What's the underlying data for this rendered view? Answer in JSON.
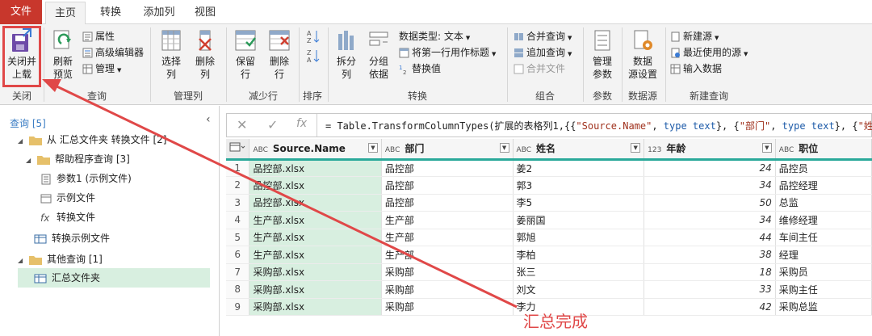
{
  "tabs": {
    "file": "文件",
    "home": "主页",
    "transform": "转换",
    "add_column": "添加列",
    "view": "视图"
  },
  "ribbon": {
    "close": {
      "button": "关闭并\n上载",
      "group": "关闭"
    },
    "query": {
      "refresh": "刷新\n预览",
      "properties": "属性",
      "advanced_editor": "高级编辑器",
      "manage": "管理",
      "group": "查询"
    },
    "manage_columns": {
      "choose": "选择\n列",
      "remove": "删除\n列",
      "group": "管理列"
    },
    "reduce_rows": {
      "keep": "保留\n行",
      "remove": "删除\n行",
      "group": "减少行"
    },
    "sort": {
      "group": "排序"
    },
    "transform": {
      "split": "拆分\n列",
      "group_by": "分组\n依据",
      "data_type": "数据类型: 文本",
      "first_row_header": "将第一行用作标题",
      "replace": "替换值",
      "group": "转换"
    },
    "combine": {
      "merge": "合并查询",
      "append": "追加查询",
      "combine_files": "合并文件",
      "group": "组合"
    },
    "params": {
      "manage": "管理\n参数",
      "group": "参数"
    },
    "datasource": {
      "settings": "数据\n源设置",
      "group": "数据源"
    },
    "new_query": {
      "new_source": "新建源",
      "recent": "最近使用的源",
      "enter_data": "输入数据",
      "group": "新建查询"
    }
  },
  "left_pane": {
    "header": "查询 [5]",
    "items": [
      {
        "label": "从 汇总文件夹 转换文件 [2]"
      },
      {
        "label": "帮助程序查询 [3]"
      },
      {
        "label": "参数1 (示例文件)"
      },
      {
        "label": "示例文件"
      },
      {
        "label": "转换文件"
      },
      {
        "label": "转换示例文件"
      },
      {
        "label": "其他查询 [1]"
      },
      {
        "label": "汇总文件夹"
      }
    ]
  },
  "formula_bar": {
    "fx": "fx",
    "formula_parts": {
      "p1": "= Table.TransformColumnTypes(扩展的表格列1,{{",
      "s1": "\"Source.Name\"",
      "p2": ", ",
      "k1": "type text",
      "p3": "}, {",
      "s2": "\"部门\"",
      "p4": ", ",
      "k2": "type text",
      "p5": "}, {",
      "s3": "\"姓名\"",
      "p6": ","
    }
  },
  "grid": {
    "columns": [
      {
        "name": "Source.Name",
        "type": "ABC"
      },
      {
        "name": "部门",
        "type": "ABC"
      },
      {
        "name": "姓名",
        "type": "ABC"
      },
      {
        "name": "年龄",
        "type": "123"
      },
      {
        "name": "职位",
        "type": "ABC"
      }
    ],
    "rows": [
      [
        "1",
        "品控部.xlsx",
        "品控部",
        "姜2",
        "24",
        "品控员"
      ],
      [
        "2",
        "品控部.xlsx",
        "品控部",
        "郭3",
        "34",
        "品控经理"
      ],
      [
        "3",
        "品控部.xlsx",
        "品控部",
        "李5",
        "50",
        "总监"
      ],
      [
        "4",
        "生产部.xlsx",
        "生产部",
        "姜丽国",
        "34",
        "维修经理"
      ],
      [
        "5",
        "生产部.xlsx",
        "生产部",
        "郭旭",
        "44",
        "车间主任"
      ],
      [
        "6",
        "生产部.xlsx",
        "生产部",
        "李柏",
        "38",
        "经理"
      ],
      [
        "7",
        "采购部.xlsx",
        "采购部",
        "张三",
        "18",
        "采购员"
      ],
      [
        "8",
        "采购部.xlsx",
        "采购部",
        "刘文",
        "33",
        "采购主任"
      ],
      [
        "9",
        "采购部.xlsx",
        "采购部",
        "李力",
        "42",
        "采购总监"
      ]
    ]
  },
  "annotation": {
    "text": "汇总完成"
  },
  "colors": {
    "file_tab": "#c8372c",
    "accent_teal": "#2aa99a",
    "selection": "#d8efe0",
    "annotation": "#e04848"
  }
}
